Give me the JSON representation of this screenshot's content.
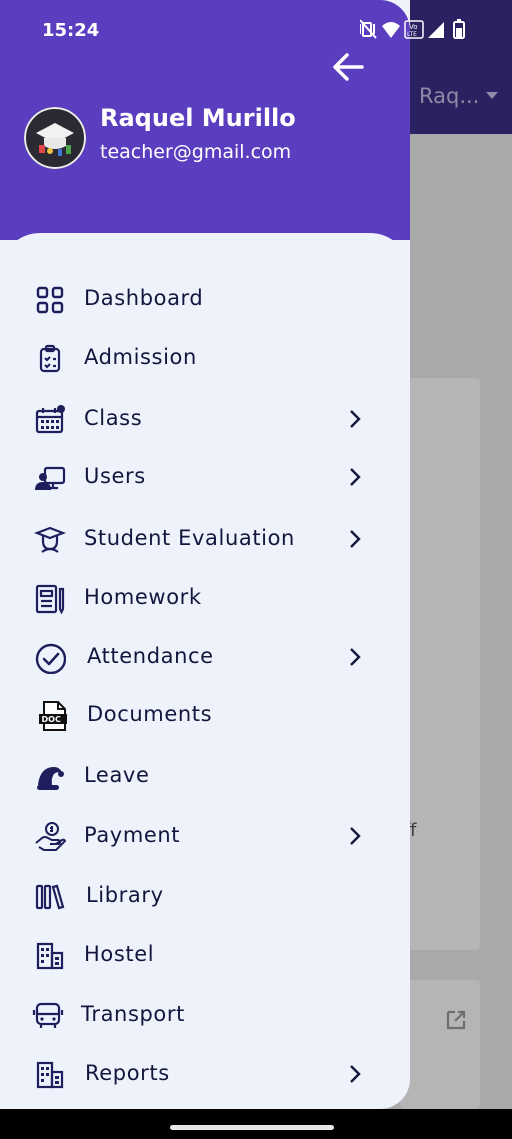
{
  "status_bar": {
    "time": "15:24",
    "volte": "Vo\nLTE"
  },
  "background": {
    "appbar_user": "Raq...",
    "partial_text": "ff"
  },
  "drawer": {
    "user_name": "Raquel Murillo",
    "user_email": "teacher@gmail.com",
    "items": [
      {
        "label": "Dashboard",
        "icon": "dashboard-icon",
        "has_submenu": false
      },
      {
        "label": "Admission",
        "icon": "clipboard-icon",
        "has_submenu": false
      },
      {
        "label": "Class",
        "icon": "calendar-icon",
        "has_submenu": true
      },
      {
        "label": "Users",
        "icon": "users-icon",
        "has_submenu": true
      },
      {
        "label": "Student Evaluation",
        "icon": "graduate-icon",
        "has_submenu": true
      },
      {
        "label": "Homework",
        "icon": "homework-icon",
        "has_submenu": false
      },
      {
        "label": "Attendance",
        "icon": "check-circle-icon",
        "has_submenu": true
      },
      {
        "label": "Documents",
        "icon": "doc-file-icon",
        "has_submenu": false
      },
      {
        "label": "Leave",
        "icon": "leave-icon",
        "has_submenu": false
      },
      {
        "label": "Payment",
        "icon": "payment-icon",
        "has_submenu": true
      },
      {
        "label": "Library",
        "icon": "library-icon",
        "has_submenu": false
      },
      {
        "label": "Hostel",
        "icon": "hostel-icon",
        "has_submenu": false
      },
      {
        "label": "Transport",
        "icon": "bus-icon",
        "has_submenu": false
      },
      {
        "label": "Reports",
        "icon": "reports-icon",
        "has_submenu": true
      }
    ]
  },
  "colors": {
    "header": "#5b3dc0",
    "drawer_bg": "#eef2fb",
    "icon": "#1e1f5c",
    "text": "#14163d"
  }
}
